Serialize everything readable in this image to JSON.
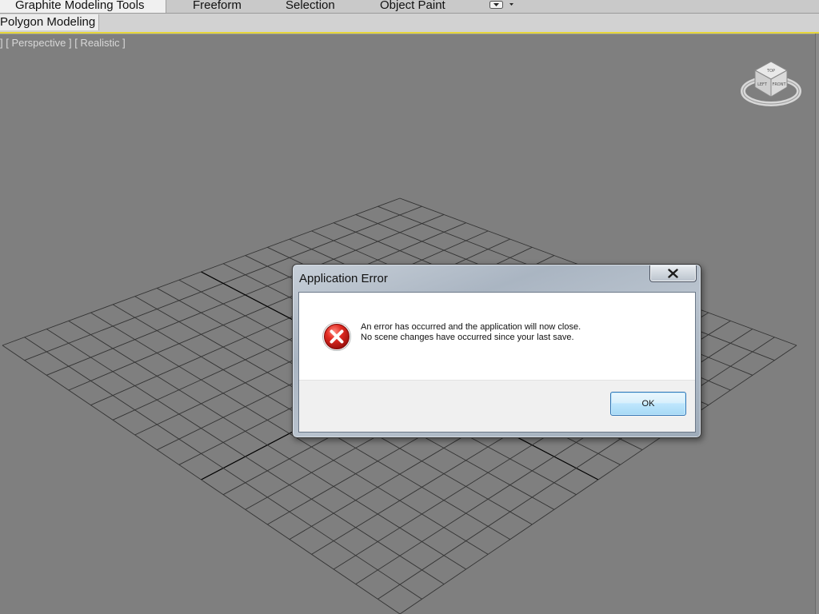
{
  "ribbon": {
    "tabs": [
      {
        "label": "Graphite Modeling Tools",
        "active": true
      },
      {
        "label": "Freeform",
        "active": false
      },
      {
        "label": "Selection",
        "active": false
      },
      {
        "label": "Object Paint",
        "active": false
      }
    ],
    "dropdown_icon": "panel-dropdown-icon"
  },
  "panel": {
    "label": "Polygon Modeling"
  },
  "viewport": {
    "label": "]  [ Perspective ]  [ Realistic ]",
    "background_color": "#7f7f7f",
    "grid_color": "#333333",
    "axis_color": "#000000"
  },
  "viewcube": {
    "faces": [
      "TOP",
      "LEFT",
      "FRONT"
    ],
    "icon": "viewcube-icon"
  },
  "dialog": {
    "title": "Application Error",
    "message_line1": "An error has occurred and the application will now close.",
    "message_line2": "No scene changes have occurred since your last save.",
    "ok_label": "OK",
    "icon": "error-icon",
    "close_icon": "close-icon"
  }
}
